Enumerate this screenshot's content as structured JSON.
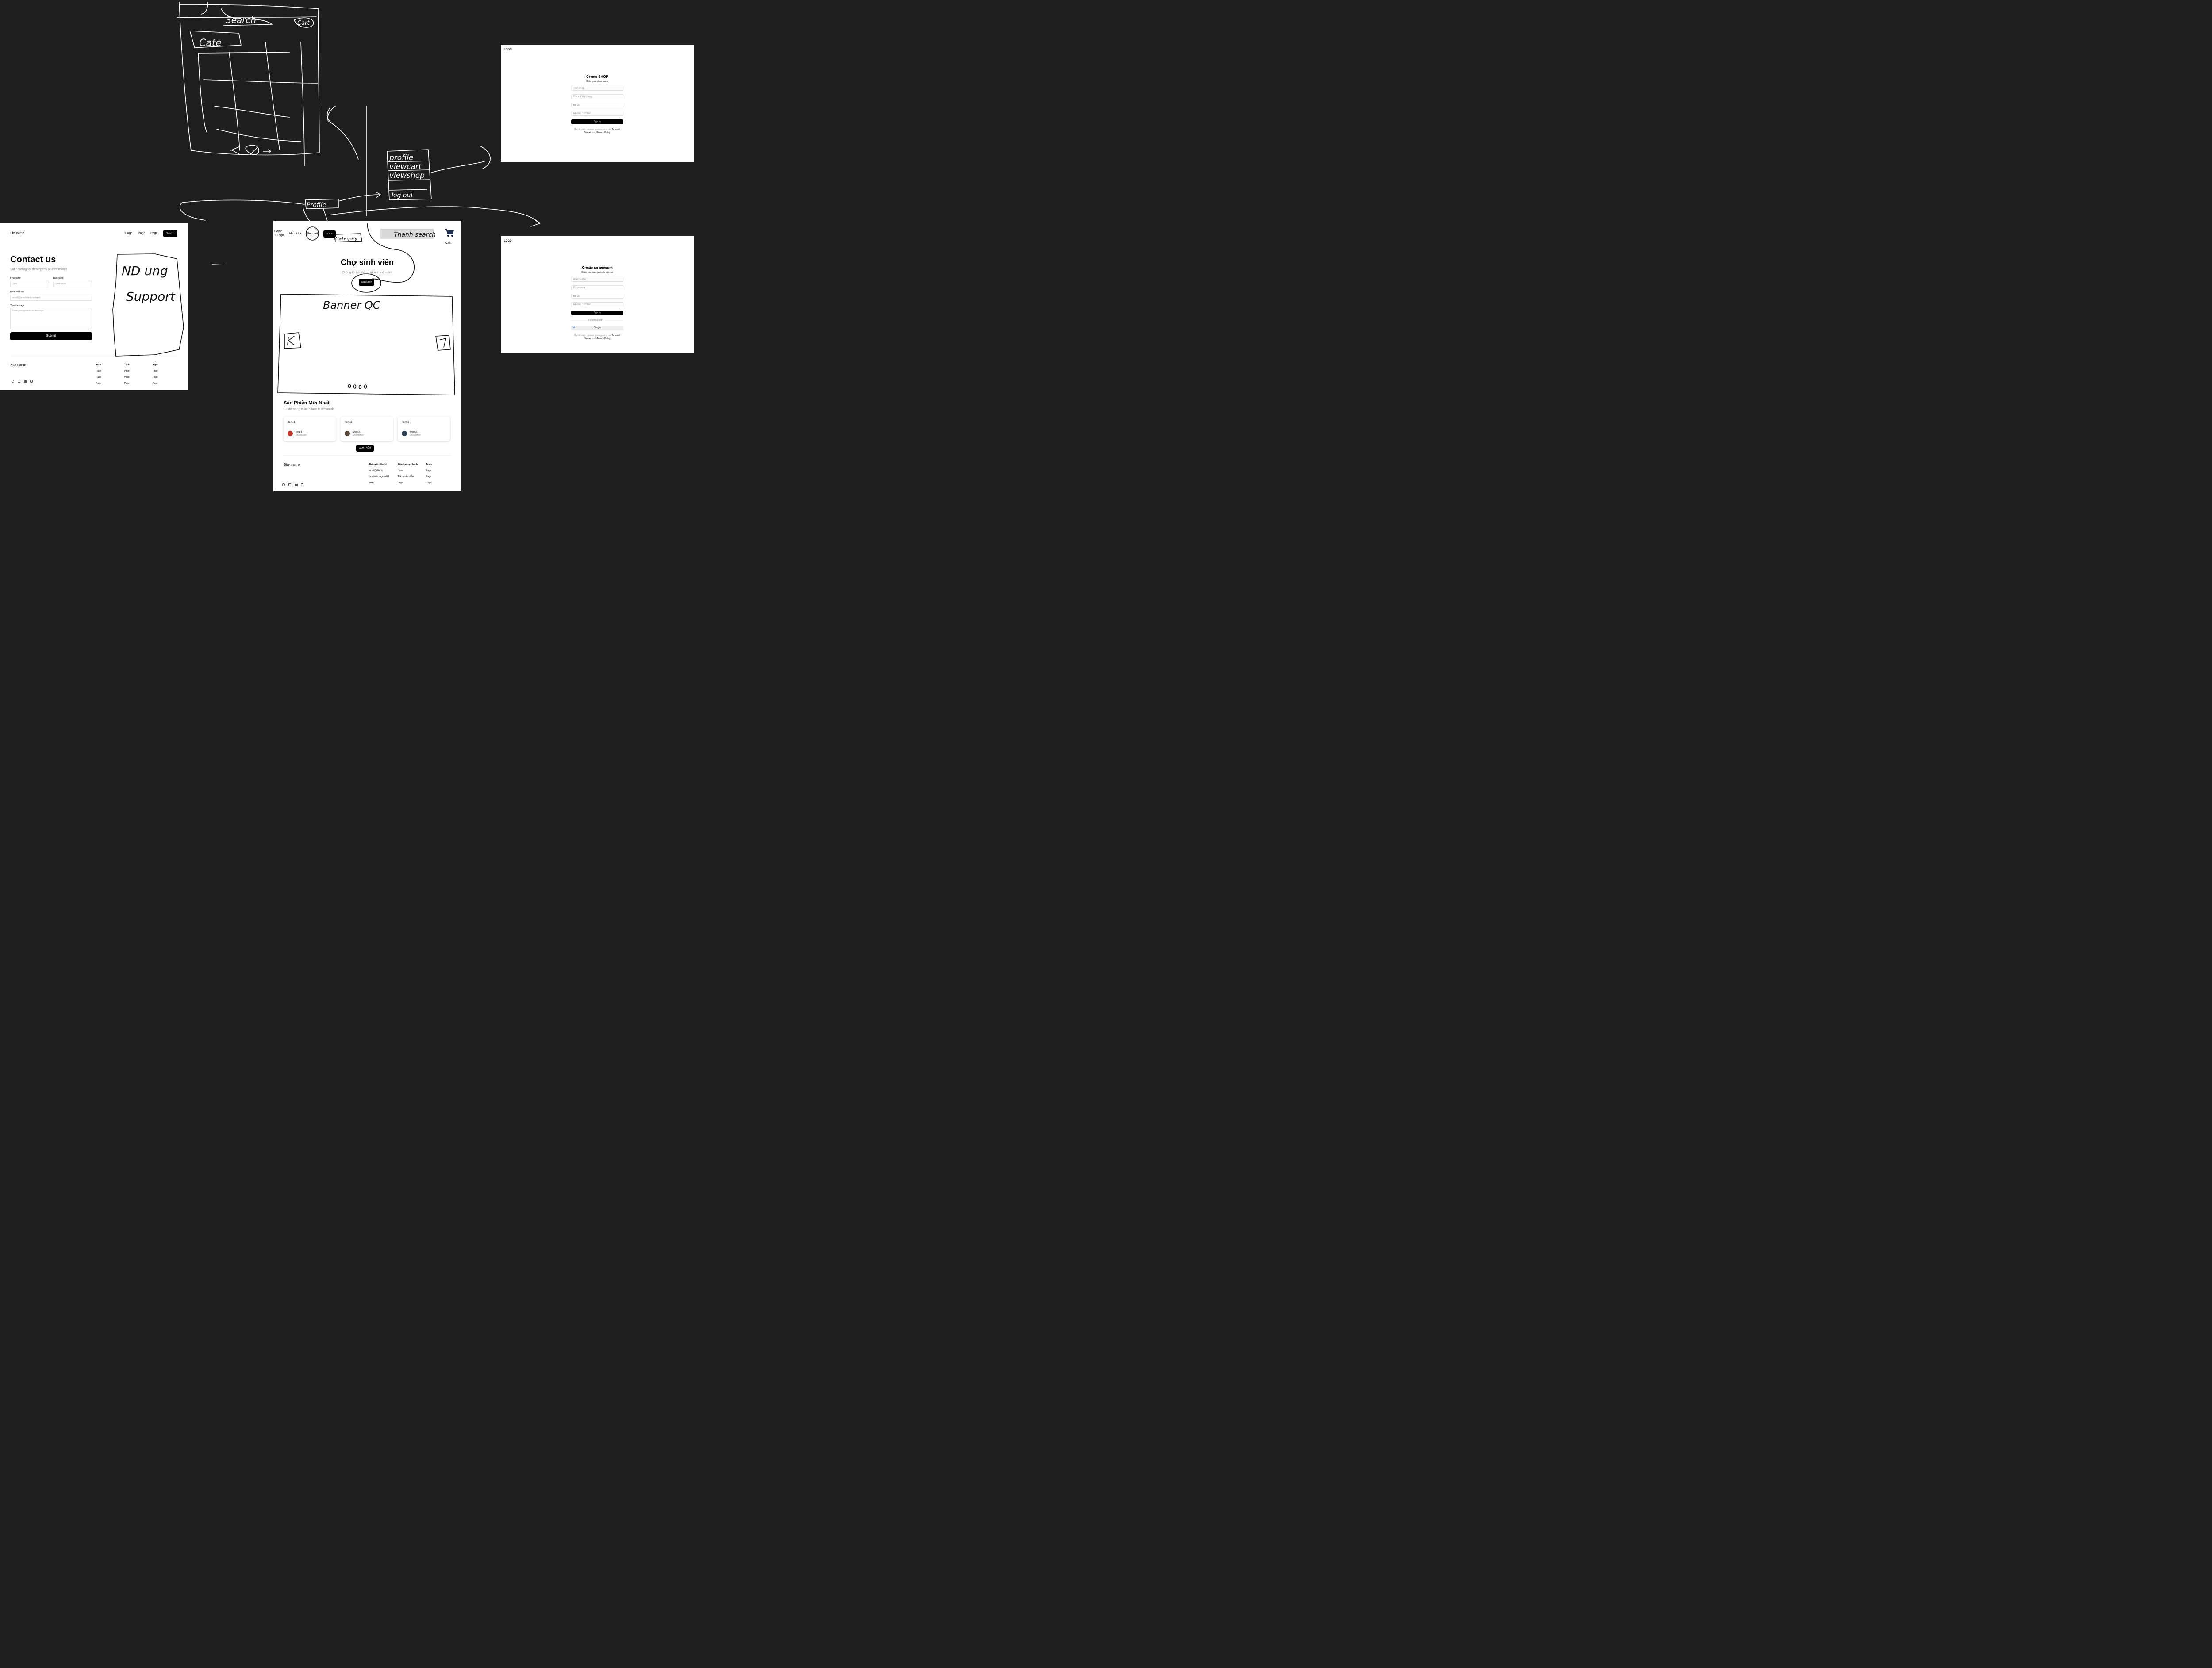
{
  "sketch_labels": {
    "search": "Search",
    "cart": "Cart",
    "cate": "Cate",
    "profile_menu": [
      "profile",
      "viewcart",
      "viewshop",
      "log out"
    ],
    "profile_btn": "Profile",
    "category_tag": "Category",
    "banner": "Banner QC",
    "nd_support_1": "ND ung",
    "nd_support_2": "Support",
    "thanh_search": "Thanh search"
  },
  "contact_page": {
    "site_name": "Site name",
    "nav": [
      "Page",
      "Page",
      "Page"
    ],
    "signup": "Sign Up",
    "title": "Contact us",
    "subtitle": "Subheading for description or instructions",
    "first_name_label": "First name",
    "first_name_placeholder": "Jane",
    "last_name_label": "Last name",
    "last_name_placeholder": "Smitherton",
    "email_label": "Email address",
    "email_placeholder": "email@janesfakedomain.net",
    "message_label": "Your message",
    "message_placeholder": "Enter your question or message",
    "submit": "Submit",
    "footer_site_name": "Site name",
    "footer_columns": [
      {
        "title": "Topic",
        "links": [
          "Page",
          "Page",
          "Page"
        ]
      },
      {
        "title": "Topic",
        "links": [
          "Page",
          "Page",
          "Page"
        ]
      },
      {
        "title": "Topic",
        "links": [
          "Page",
          "Page",
          "Page"
        ]
      }
    ],
    "social_icons": [
      "facebook-icon",
      "linkedin-icon",
      "youtube-icon",
      "instagram-icon"
    ]
  },
  "home_page": {
    "nav_home": "Home",
    "nav_logo": "+ Logo",
    "nav_about": "About Us",
    "nav_support": "Support",
    "login": "LOGIN",
    "cart_label": "Cart",
    "hero_title": "Chợ sinh viên",
    "hero_subtitle": "Chúng tôi có những gì sinh viên cần!",
    "hero_button": "Mua Ngay",
    "section_title": "Sản Phẩm Mới Nhất",
    "section_subtitle": "Subheading to introduce testimonials",
    "items": [
      {
        "title": "Item 1",
        "shop": "shop 1",
        "desc": "Description",
        "avatar_color": "#c0392b"
      },
      {
        "title": "Item 2",
        "shop": "Shop 2",
        "desc": "Description",
        "avatar_color": "#5a4a3a"
      },
      {
        "title": "Item 3",
        "shop": "Shop 3",
        "desc": "Description",
        "avatar_color": "#2c3e50"
      }
    ],
    "more_button": "XEM THÊM",
    "footer_site_name": "Site name",
    "footer_columns": [
      {
        "title": "Thông tin liên hệ",
        "links": [
          "email@dâsda",
          "facebook page adâd",
          "smth"
        ]
      },
      {
        "title": "Điều hướng nhanh",
        "links": [
          "Home",
          "Tất cả sản phẩm",
          "Page"
        ]
      },
      {
        "title": "Topic",
        "links": [
          "Page",
          "Page",
          "Page"
        ]
      }
    ]
  },
  "shop_page": {
    "logo": "LOGO",
    "title": "Create SHOP",
    "subtitle": "Enter your shop name",
    "fields": [
      "Tên shop",
      "Địa chỉ lấy hàng",
      "Email",
      "Phone number"
    ],
    "button": "Sign up",
    "legal_prefix": "By clicking continue, you agree to our",
    "terms": "Terms of Service",
    "and": "and",
    "privacy": "Privacy Policy"
  },
  "account_page": {
    "logo": "LOGO",
    "title": "Create an account",
    "subtitle": "Enter your user name to sign up",
    "fields": [
      "user name",
      "Password",
      "Email",
      "Phone number"
    ],
    "button": "Sign up",
    "divider": "or continue with",
    "google": "Google",
    "legal_prefix": "By clicking continue, you agree to our",
    "terms": "Terms of Service",
    "and": "and",
    "privacy": "Privacy Policy"
  },
  "colors": {
    "background": "#1e1e1e",
    "cart_icon": "#1f2d4d",
    "search_bar": "#d9d9d9"
  }
}
